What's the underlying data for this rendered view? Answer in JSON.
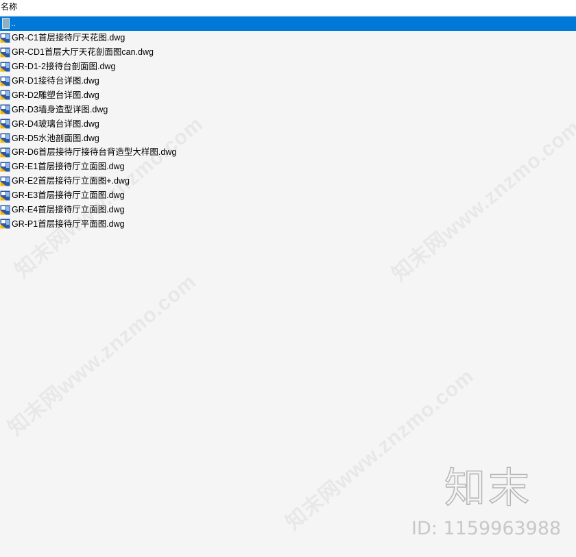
{
  "header": {
    "column_name": "名称"
  },
  "files": {
    "parent": {
      "label": ".."
    },
    "items": [
      {
        "label": "GR-C1首层接待厅天花图.dwg"
      },
      {
        "label": "GR-CD1首层大厅天花剖面图can.dwg"
      },
      {
        "label": "GR-D1-2接待台剖面图.dwg"
      },
      {
        "label": "GR-D1接待台详图.dwg"
      },
      {
        "label": "GR-D2雕塑台详图.dwg"
      },
      {
        "label": "GR-D3墙身造型详图.dwg"
      },
      {
        "label": "GR-D4玻璃台详图.dwg"
      },
      {
        "label": "GR-D5水池剖面图.dwg"
      },
      {
        "label": "GR-D6首层接待厅接待台背造型大样图.dwg"
      },
      {
        "label": "GR-E1首层接待厅立面图.dwg"
      },
      {
        "label": "GR-E2首层接待厅立面图+.dwg"
      },
      {
        "label": "GR-E3首层接待厅立面图.dwg"
      },
      {
        "label": "GR-E4首层接待厅立面图.dwg"
      },
      {
        "label": "GR-P1首层接待厅平面图.dwg"
      }
    ]
  },
  "watermark": {
    "text": "知末网www.znzmo.com",
    "logo": "知末",
    "id_text": "ID: 1159963988"
  },
  "colors": {
    "selection": "#0078d7",
    "background": "#f5f5f5",
    "header_bg": "#ffffff"
  }
}
